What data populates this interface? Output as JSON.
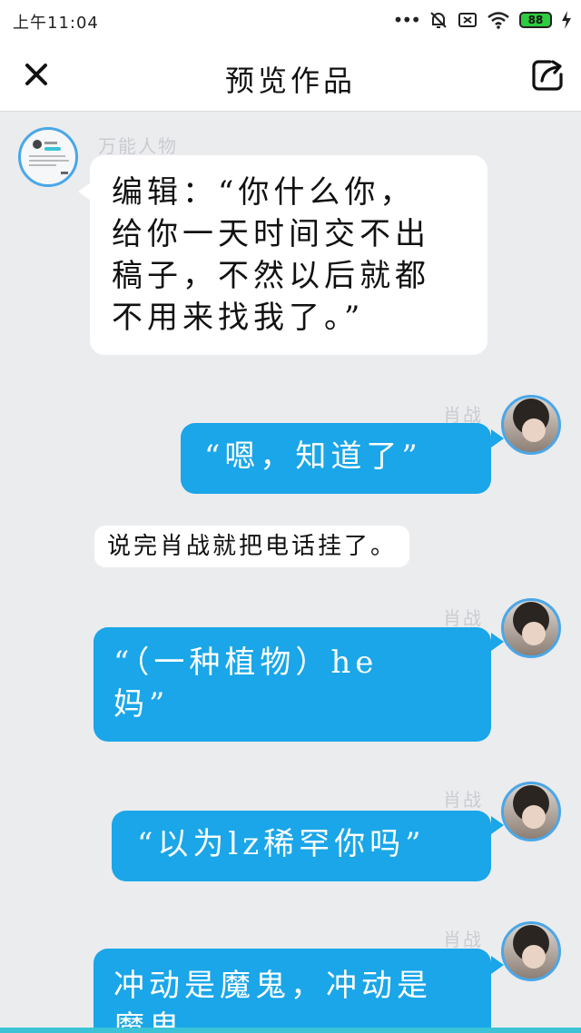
{
  "status_bar": {
    "time": "上午11:04",
    "battery": "88",
    "icons": [
      "more-dots-icon",
      "bell-muted-icon",
      "sim-x-icon",
      "wifi-icon",
      "battery-icon",
      "charging-bolt-icon"
    ]
  },
  "header": {
    "title": "预览作品",
    "close_icon": "close-icon",
    "share_icon": "share-icon"
  },
  "messages": [
    {
      "speaker": "万能人物",
      "side": "left",
      "text_lines": [
        "编辑：“你什么你，",
        "给你一天时间交不出",
        "稿子，不然以后就都",
        "不用来找我了。”"
      ]
    },
    {
      "speaker": "肖战",
      "side": "right",
      "text_lines": [
        "“嗯，知道了”"
      ]
    },
    {
      "type": "narration",
      "text": "说完肖战就把电话挂了。"
    },
    {
      "speaker": "肖战",
      "side": "right",
      "text_lines": [
        "“（一种植物）he",
        "妈”"
      ]
    },
    {
      "speaker": "肖战",
      "side": "right",
      "text_lines": [
        "“以为lz稀罕你吗”"
      ]
    },
    {
      "speaker": "肖战",
      "side": "right",
      "text_lines": [
        "冲动是魔鬼，冲动是",
        "魔鬼"
      ]
    }
  ],
  "colors": {
    "accent": "#1aa6e8",
    "avatar_border": "#4aa7e8",
    "background": "#ebecee",
    "bottom_strip": "#3cc3d6"
  }
}
